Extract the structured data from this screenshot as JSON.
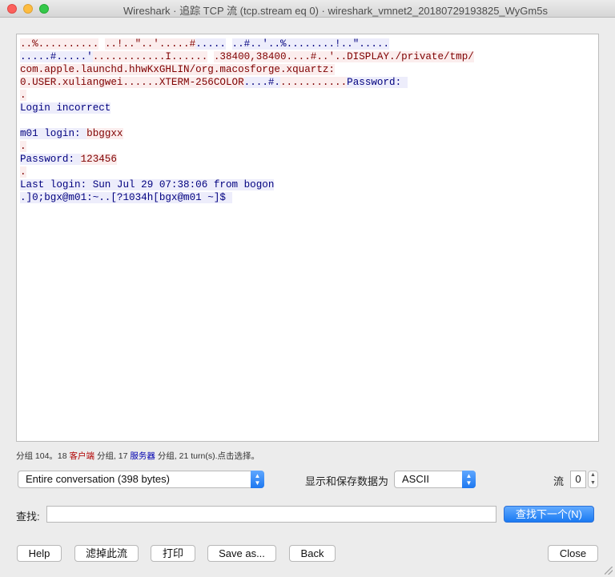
{
  "window": {
    "title": "Wireshark · 追踪 TCP 流 (tcp.stream eq 0) · wireshark_vmnet2_20180729193825_WyGm5s"
  },
  "stream_lines": [
    {
      "segments": [
        {
          "text": "..%..........",
          "kind": "c"
        },
        {
          "text": " ",
          "kind": ""
        },
        {
          "text": "..!..\"..'.....#",
          "kind": "c"
        },
        {
          "text": ".....",
          "kind": "s"
        },
        {
          "text": " ",
          "kind": ""
        },
        {
          "text": "..#..'..%........!..\".....",
          "kind": "s"
        }
      ]
    },
    {
      "segments": [
        {
          "text": ".....#.....'",
          "kind": "s"
        },
        {
          "text": "............I......",
          "kind": "c"
        },
        {
          "text": " ",
          "kind": ""
        },
        {
          "text": ".38400,38400....#..'..DISPLAY./private/tmp/",
          "kind": "c"
        }
      ]
    },
    {
      "segments": [
        {
          "text": "com.apple.launchd.hhwKxGHLIN/org.macosforge.xquartz:",
          "kind": "c"
        }
      ]
    },
    {
      "segments": [
        {
          "text": "0.USER.xuliangwei......XTERM-256COLOR",
          "kind": "c"
        },
        {
          "text": "....#.",
          "kind": "s"
        },
        {
          "text": "...........",
          "kind": "c"
        },
        {
          "text": "Password: ",
          "kind": "s"
        }
      ]
    },
    {
      "segments": [
        {
          "text": ".",
          "kind": "c"
        }
      ]
    },
    {
      "segments": [
        {
          "text": "Login incorrect",
          "kind": "s"
        }
      ]
    },
    {
      "segments": [
        {
          "text": "",
          "kind": ""
        }
      ]
    },
    {
      "segments": [
        {
          "text": "m01 login: ",
          "kind": "s"
        },
        {
          "text": "bbggxx",
          "kind": "c"
        }
      ]
    },
    {
      "segments": [
        {
          "text": ".",
          "kind": "c"
        }
      ]
    },
    {
      "segments": [
        {
          "text": "Password: ",
          "kind": "s"
        },
        {
          "text": "123456",
          "kind": "c"
        }
      ]
    },
    {
      "segments": [
        {
          "text": ".",
          "kind": "c"
        }
      ]
    },
    {
      "segments": [
        {
          "text": "Last login: Sun Jul 29 07:38:06 from bogon",
          "kind": "s"
        }
      ]
    },
    {
      "segments": [
        {
          "text": ".]0;bgx@m01:~..[?1034h[bgx@m01 ~]$ ",
          "kind": "s"
        }
      ]
    }
  ],
  "info": {
    "prefix": "分组 104。18 ",
    "client": "客户端",
    "mid1": " 分组, 17 ",
    "server": "服务器",
    "suffix": " 分组, 21 turn(s).点击选择。"
  },
  "controls": {
    "conversation_select": "Entire conversation (398 bytes)",
    "display_label": "显示和保存数据为",
    "format_select": "ASCII",
    "stream_label": "流",
    "stream_value": "0",
    "find_label": "查找:",
    "find_value": "",
    "find_next": "查找下一个(N)"
  },
  "buttons": {
    "help": "Help",
    "filter_out": "滤掉此流",
    "print": "打印",
    "save_as": "Save as...",
    "back": "Back",
    "close": "Close"
  },
  "colors": {
    "client_text": "#7f0000",
    "client_bg": "#fbeded",
    "server_text": "#00007f",
    "server_bg": "#ededfb"
  }
}
